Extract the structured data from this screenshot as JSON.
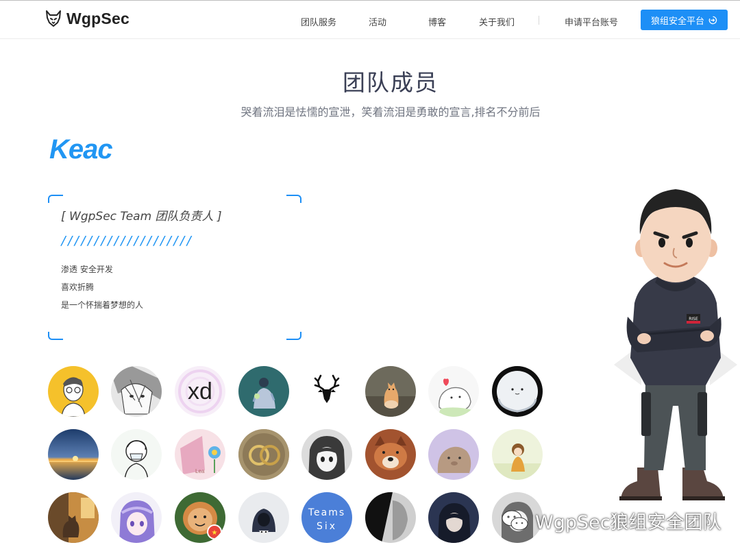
{
  "header": {
    "brand": "WgpSec",
    "nav": [
      "团队服务",
      "活动",
      "博客",
      "关于我们",
      "申请平台账号"
    ],
    "platform_button": "狼组安全平台",
    "icons": {
      "logo": "wolf-logo-icon",
      "platform": "login-arrow-icon"
    },
    "accent": "#1d8ff6"
  },
  "page": {
    "title": "团队成员",
    "subtitle": "哭着流泪是怯懦的宣泄，笑着流泪是勇敢的宣言,排名不分前后"
  },
  "member": {
    "name": "Keac",
    "role": "[ WgpSec Team 团队负责人 ]",
    "slashes": "////////////////////",
    "lines": [
      "渗透 安全开发",
      "喜欢折腾",
      "是一个怀揣着梦想的人"
    ]
  },
  "avatar_texts": {
    "xd": "xd",
    "teams_six_line1": "Teams",
    "teams_six_line2": "Six",
    "lea": "Lea",
    "rise": "RISE"
  },
  "watermark": "WgpSec狼组安全团队",
  "colors": {
    "accent": "#2196f3",
    "title": "#3a3f55",
    "subtitle": "#6f7480"
  }
}
